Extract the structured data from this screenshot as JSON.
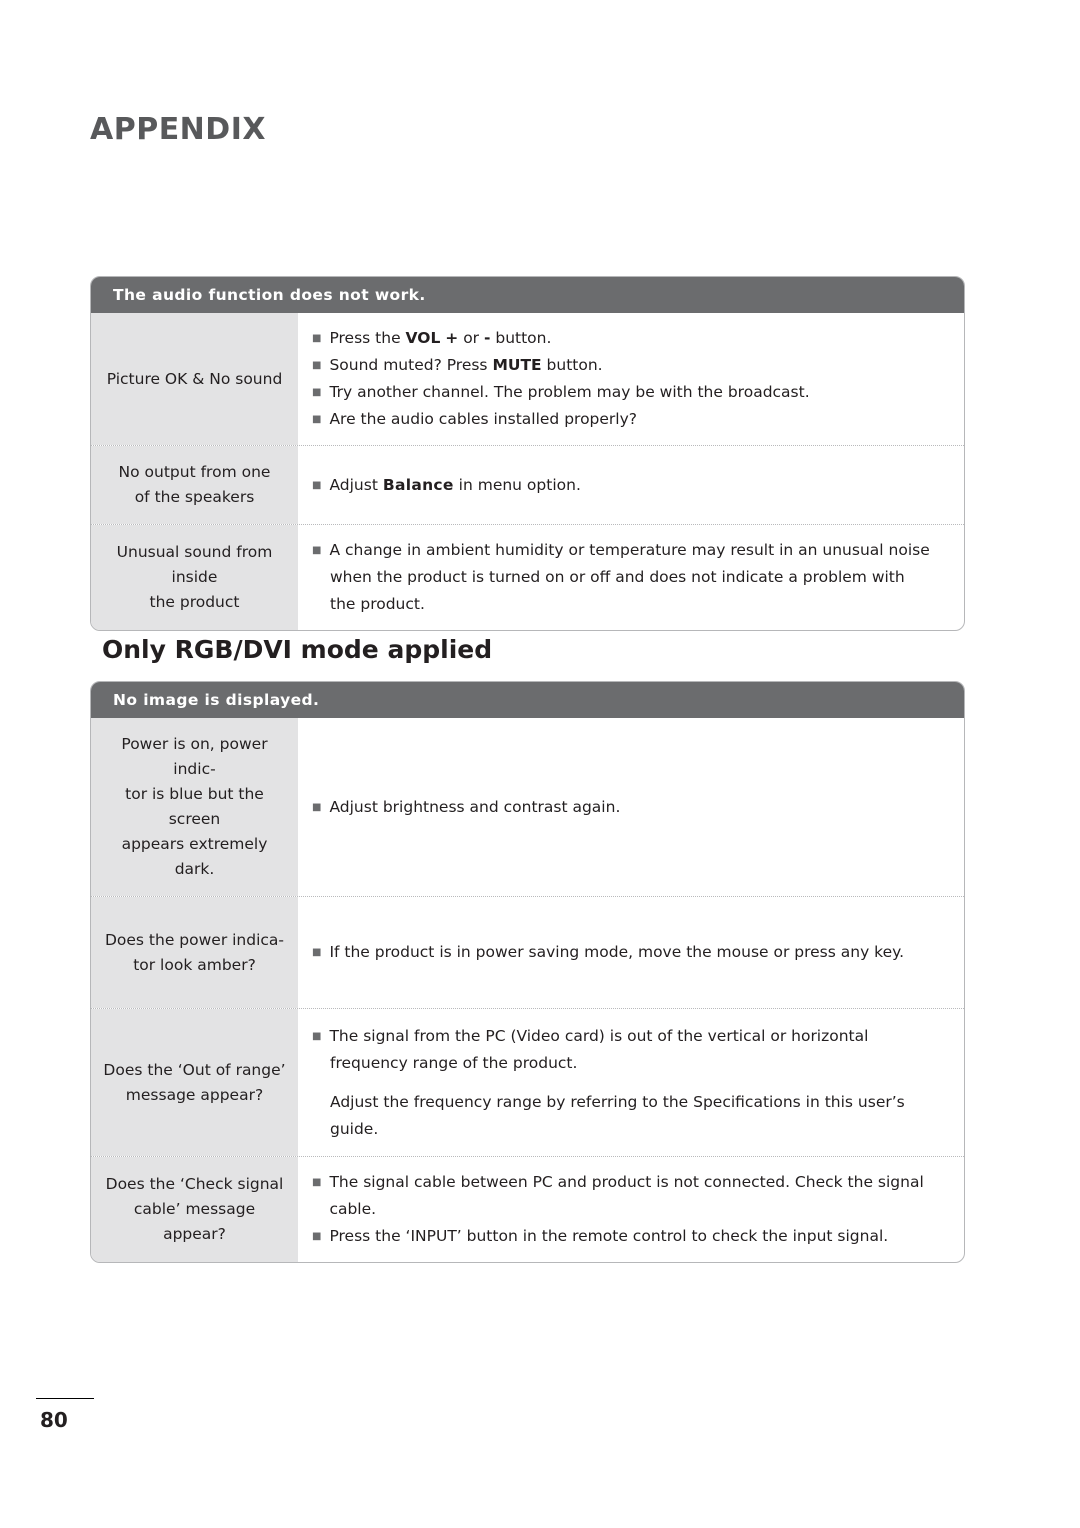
{
  "page": {
    "title": "APPENDIX",
    "number": "80",
    "sub_heading": "Only RGB/DVI mode applied"
  },
  "table_audio": {
    "header": "The audio function does not work.",
    "rows": [
      {
        "label": "Picture OK & No sound",
        "lines": [
          {
            "bullet": true,
            "segments": [
              {
                "text": "Press the "
              },
              {
                "text": "VOL",
                "bold": true
              },
              {
                "text": " "
              },
              {
                "text": "+",
                "bold": true
              },
              {
                "text": " or "
              },
              {
                "text": "-",
                "bold": true
              },
              {
                "text": " button."
              }
            ]
          },
          {
            "bullet": true,
            "segments": [
              {
                "text": "Sound muted? Press "
              },
              {
                "text": "MUTE",
                "bold": true
              },
              {
                "text": " button."
              }
            ]
          },
          {
            "bullet": true,
            "segments": [
              {
                "text": "Try another channel. The problem may be with the broadcast."
              }
            ]
          },
          {
            "bullet": true,
            "segments": [
              {
                "text": "Are the audio cables installed properly?"
              }
            ]
          }
        ]
      },
      {
        "label": "No output from one\nof the speakers",
        "lines": [
          {
            "bullet": true,
            "segments": [
              {
                "text": "Adjust "
              },
              {
                "text": "Balance",
                "balance": true
              },
              {
                "text": " in menu option."
              }
            ]
          }
        ]
      },
      {
        "label": "Unusual sound from\ninside\nthe product",
        "lines": [
          {
            "bullet": true,
            "segments": [
              {
                "text": "A change in ambient humidity or temperature may result in an unusual noise"
              }
            ]
          },
          {
            "bullet": false,
            "segments": [
              {
                "text": "when the product is turned on or off and does not indicate a problem with"
              }
            ]
          },
          {
            "bullet": false,
            "segments": [
              {
                "text": "the product."
              }
            ]
          }
        ]
      }
    ]
  },
  "table_rgb": {
    "header": "No image is displayed.",
    "rows": [
      {
        "label": "Power is on, power indic-\ntor is blue but the screen\nappears extremely dark.",
        "lines": [
          {
            "bullet": true,
            "segments": [
              {
                "text": "Adjust brightness and contrast again."
              }
            ]
          }
        ]
      },
      {
        "label": "Does the power indica-\ntor look amber?",
        "lines": [
          {
            "bullet": true,
            "segments": [
              {
                "text": "If the product is in power saving mode, move the mouse or press any key."
              }
            ]
          }
        ]
      },
      {
        "label": "Does the ‘Out of range’\nmessage appear?",
        "lines": [
          {
            "bullet": true,
            "segments": [
              {
                "text": "The signal from the PC (Video card) is out of the vertical or horizontal"
              }
            ]
          },
          {
            "bullet": false,
            "segments": [
              {
                "text": "frequency range of the product."
              }
            ]
          },
          {
            "bullet": false,
            "segments": [
              {
                "text": ""
              }
            ]
          },
          {
            "bullet": false,
            "segments": [
              {
                "text": "Adjust the frequency range by referring to the Specifications in this user’s guide."
              }
            ]
          }
        ]
      },
      {
        "label": "Does the ‘Check signal\ncable’ message appear?",
        "lines": [
          {
            "bullet": true,
            "segments": [
              {
                "text": "The signal cable between PC and product is not connected. Check the signal cable."
              }
            ]
          },
          {
            "bullet": true,
            "segments": [
              {
                "text": "Press the  ‘INPUT’ button in the remote control to check the input signal."
              }
            ]
          }
        ]
      }
    ]
  }
}
